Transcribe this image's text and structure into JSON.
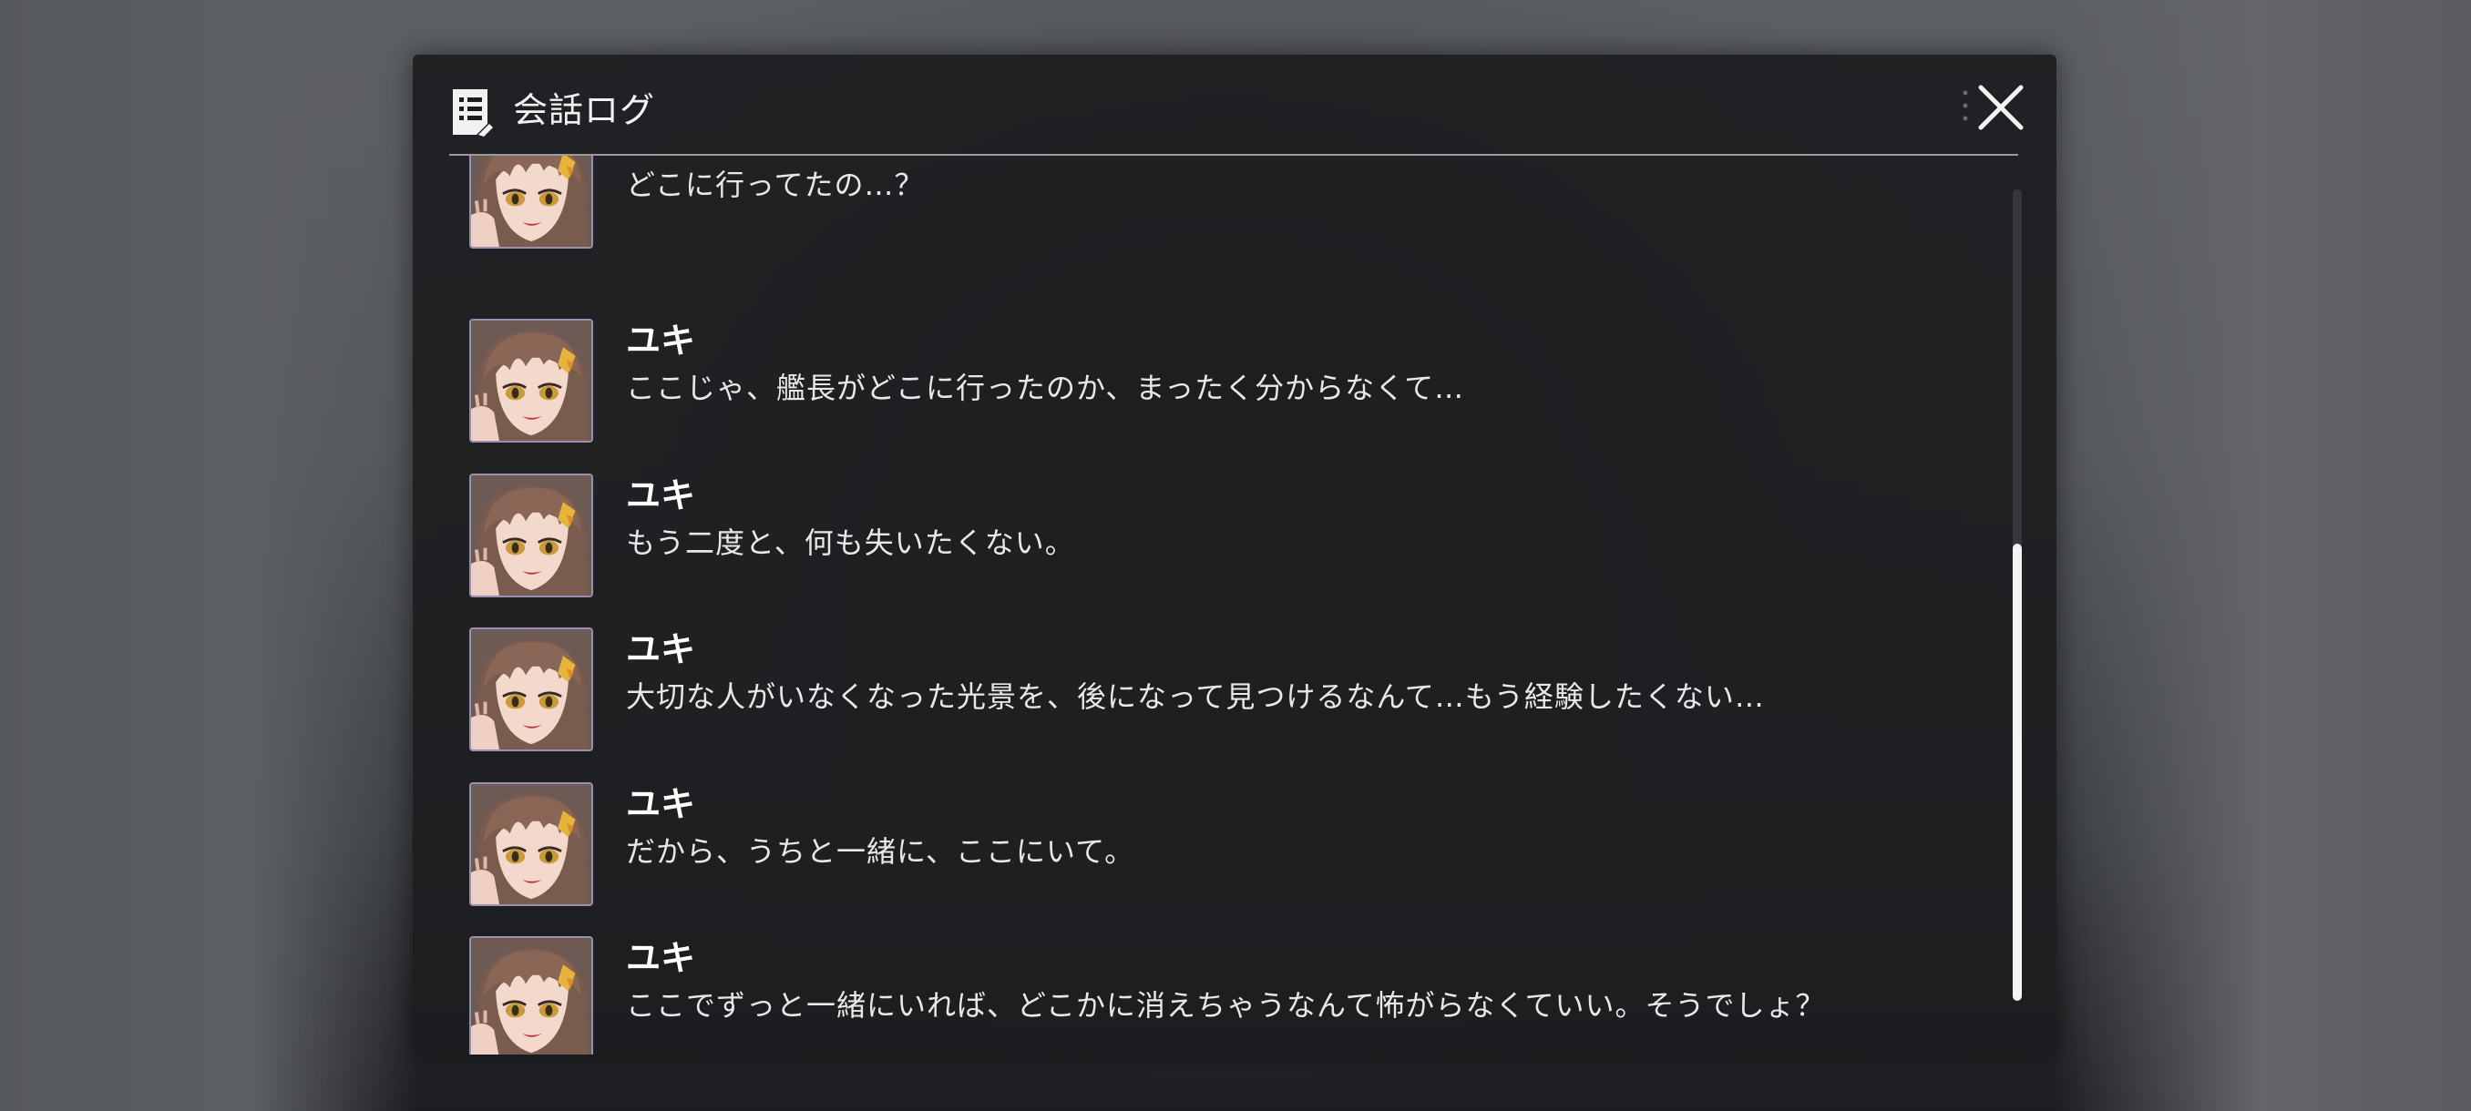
{
  "dialog": {
    "title": "会話ログ",
    "icon": "log-document-icon",
    "close_icon": "close-icon"
  },
  "log": [
    {
      "speaker": "",
      "text": "どこに行ってたの…？",
      "avatar": "yuki-portrait"
    },
    {
      "speaker": "ユキ",
      "text": "ここじゃ、艦長がどこに行ったのか、まったく分からなくて…",
      "avatar": "yuki-portrait"
    },
    {
      "speaker": "ユキ",
      "text": "もう二度と、何も失いたくない。",
      "avatar": "yuki-portrait"
    },
    {
      "speaker": "ユキ",
      "text": "大切な人がいなくなった光景を、後になって見つけるなんて…もう経験したくない…",
      "avatar": "yuki-portrait"
    },
    {
      "speaker": "ユキ",
      "text": "だから、うちと一緒に、ここにいて。",
      "avatar": "yuki-portrait"
    },
    {
      "speaker": "ユキ",
      "text": "ここでずっと一緒にいれば、どこかに消えちゃうなんて怖がらなくていい。そうでしょ？",
      "avatar": "yuki-portrait"
    }
  ],
  "colors": {
    "panel": "#1c1d1f",
    "text": "#e8e8e8",
    "scroll_thumb": "#f4f4f4",
    "avatar_border": "#9a8fb0"
  },
  "scroll_position": 0.44
}
